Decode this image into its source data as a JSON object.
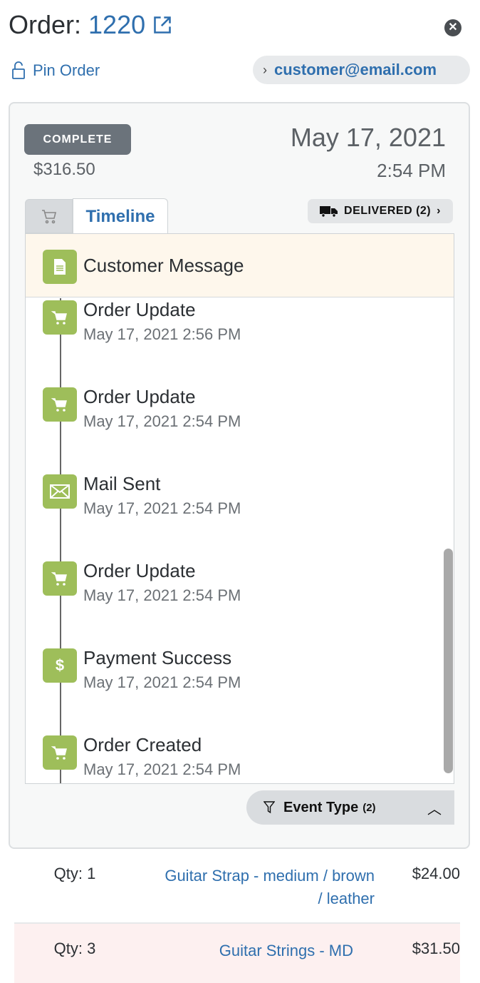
{
  "header": {
    "title_label": "Order:",
    "order_number": "1220",
    "close_icon": "close-circle-icon"
  },
  "pin": {
    "label": "Pin Order",
    "icon": "unlock-icon"
  },
  "customer": {
    "email": "customer@email.com"
  },
  "summary": {
    "status": "COMPLETE",
    "total": "$316.50",
    "date": "May 17, 2021",
    "time": "2:54 PM"
  },
  "tabs": [
    {
      "icon": "cart-icon"
    },
    {
      "label": "Timeline",
      "active": true
    }
  ],
  "delivery": {
    "label": "DELIVERED (2)",
    "icon": "truck-icon"
  },
  "timeline": {
    "pinned": {
      "title": "Customer Message",
      "icon": "document-icon"
    },
    "events": [
      {
        "title": "Order Update",
        "date": "May 17, 2021 2:56 PM",
        "icon": "cart-icon"
      },
      {
        "title": "Order Update",
        "date": "May 17, 2021 2:54 PM",
        "icon": "cart-icon"
      },
      {
        "title": "Mail Sent",
        "date": "May 17, 2021 2:54 PM",
        "icon": "envelope-icon"
      },
      {
        "title": "Order Update",
        "date": "May 17, 2021 2:54 PM",
        "icon": "cart-icon"
      },
      {
        "title": "Payment Success",
        "date": "May 17, 2021 2:54 PM",
        "icon": "dollar-icon"
      },
      {
        "title": "Order Created",
        "date": "May 17, 2021 2:54 PM",
        "icon": "cart-icon"
      }
    ]
  },
  "filter": {
    "label": "Event Type",
    "count": "(2)"
  },
  "line_items": [
    {
      "qty": "Qty: 1",
      "product": "Guitar Strap - medium / brown / leather",
      "price": "$24.00"
    },
    {
      "qty": "Qty: 3",
      "product": "Guitar Strings - MD",
      "price": "$31.50",
      "highlight": "#fdf0f0"
    }
  ],
  "colors": {
    "accent": "#2f6fae",
    "event_icon": "#9ebe5a",
    "status_badge": "#6b737b"
  }
}
